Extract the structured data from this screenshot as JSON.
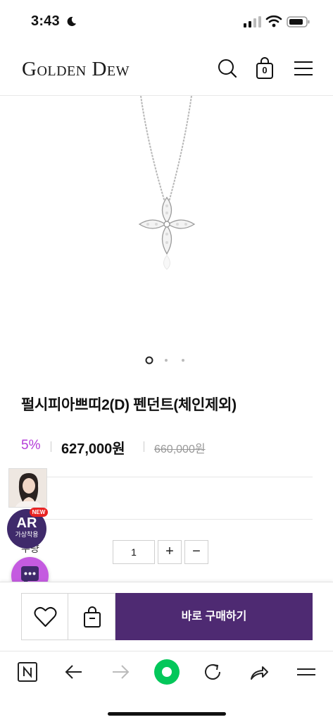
{
  "status_bar": {
    "time": "3:43"
  },
  "header": {
    "logo": "Golden Dew",
    "cart_count": "0"
  },
  "product": {
    "title": "펄시피아쁘띠2(D) 펜던트(체인제외)",
    "discount": "5%",
    "price": "627,000원",
    "original_price": "660,000원",
    "carousel": {
      "current": 1,
      "total": 3
    }
  },
  "options": {
    "quantity_label": "수량",
    "quantity_value": "1",
    "plus": "+",
    "minus": "−"
  },
  "floating": {
    "ar_label": "AR",
    "ar_sub": "가상착용",
    "new_tag": "NEW"
  },
  "buy_bar": {
    "buy_now": "바로 구매하기"
  },
  "browser_toolbar": {
    "icons": [
      "naver-icon",
      "back-icon",
      "forward-icon",
      "green-dot-icon",
      "reload-icon",
      "share-icon",
      "menu-icon"
    ]
  },
  "colors": {
    "accent_purple": "#4e2a72",
    "discount_purple": "#b43cd8",
    "chat_purple": "#c45be0",
    "naver_green": "#03c75a"
  }
}
